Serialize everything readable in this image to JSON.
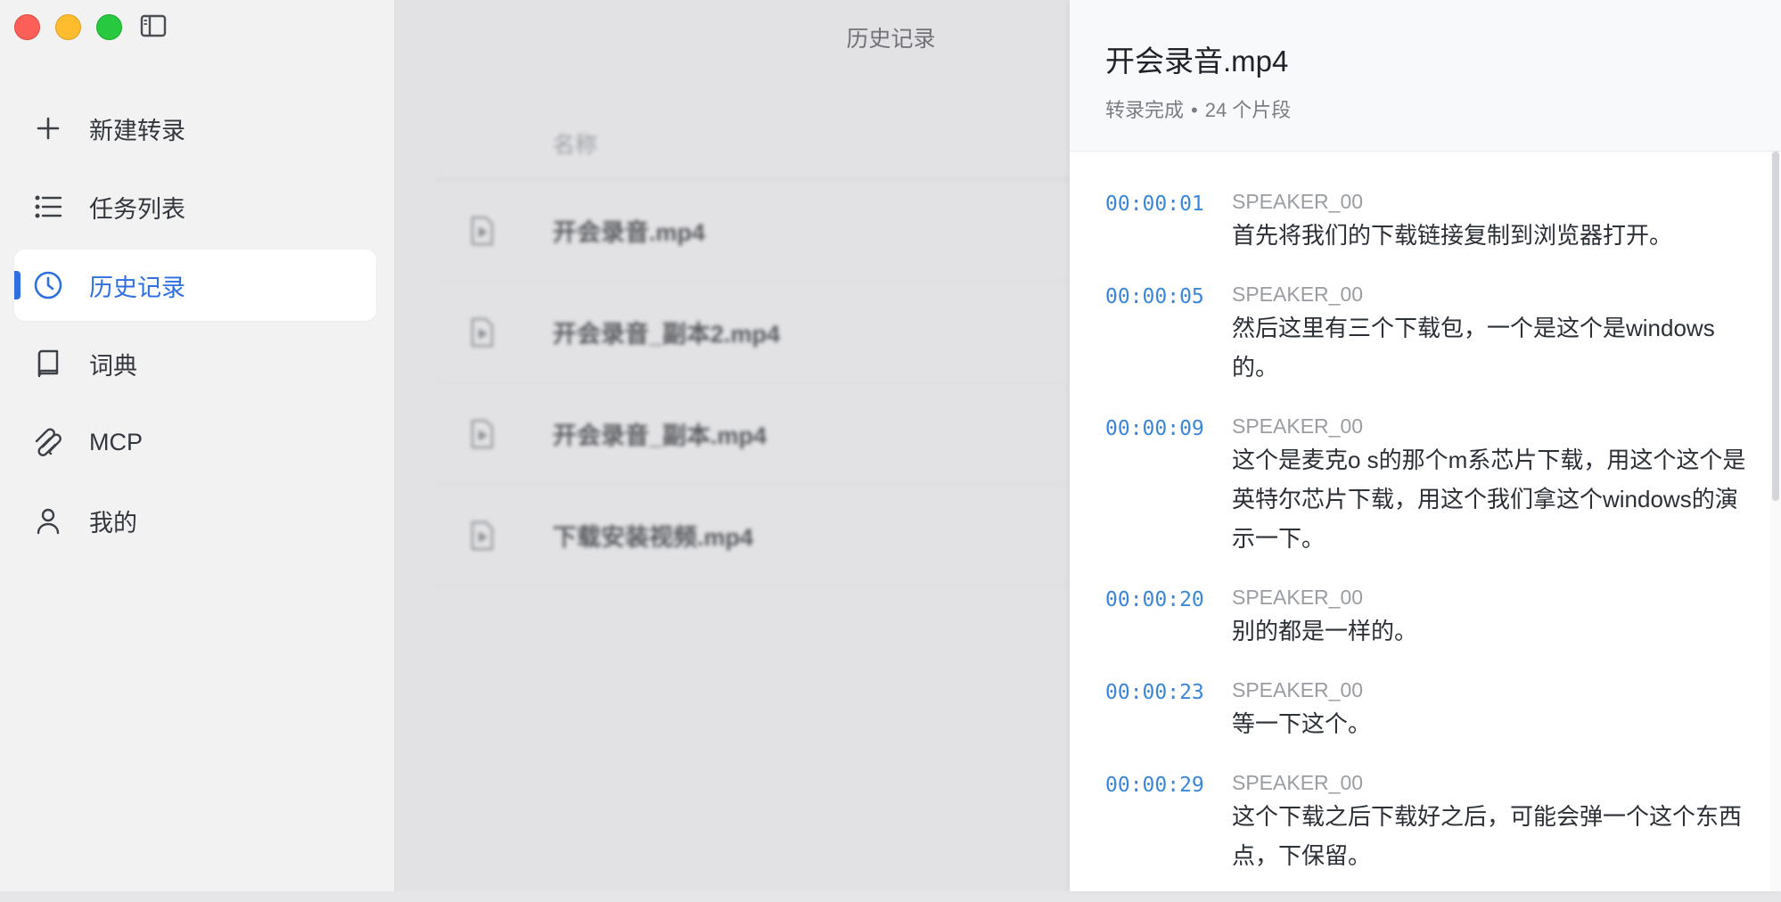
{
  "window": {
    "controls": [
      "close",
      "minimize",
      "zoom"
    ]
  },
  "sidebar": {
    "items": [
      {
        "label": "新建转录",
        "icon": "plus-icon"
      },
      {
        "label": "任务列表",
        "icon": "list-icon"
      },
      {
        "label": "历史记录",
        "icon": "clock-icon",
        "active": true
      },
      {
        "label": "词典",
        "icon": "book-icon"
      },
      {
        "label": "MCP",
        "icon": "mcp-icon"
      },
      {
        "label": "我的",
        "icon": "user-icon"
      }
    ]
  },
  "main": {
    "title": "历史记录",
    "column_header": "名称",
    "files": [
      {
        "name": "开会录音.mp4"
      },
      {
        "name": "开会录音_副本2.mp4"
      },
      {
        "name": "开会录音_副本.mp4"
      },
      {
        "name": "下载安装视频.mp4"
      }
    ]
  },
  "panel": {
    "title": "开会录音.mp4",
    "status": "转录完成",
    "separator": "•",
    "segment_count": "24 个片段",
    "segments": [
      {
        "time": "00:00:01",
        "speaker": "SPEAKER_00",
        "text": "首先将我们的下载链接复制到浏览器打开。"
      },
      {
        "time": "00:00:05",
        "speaker": "SPEAKER_00",
        "text": "然后这里有三个下载包，一个是这个是windows的。"
      },
      {
        "time": "00:00:09",
        "speaker": "SPEAKER_00",
        "text": "这个是麦克o s的那个m系芯片下载，用这个这个是英特尔芯片下载，用这个我们拿这个windows的演示一下。"
      },
      {
        "time": "00:00:20",
        "speaker": "SPEAKER_00",
        "text": "别的都是一样的。"
      },
      {
        "time": "00:00:23",
        "speaker": "SPEAKER_00",
        "text": "等一下这个。"
      },
      {
        "time": "00:00:29",
        "speaker": "SPEAKER_00",
        "text": "这个下载之后下载好之后，可能会弹一个这个东西点，下保留。"
      }
    ]
  },
  "colors": {
    "accent": "#2f6fe0",
    "timestamp": "#3a86d8",
    "close": "#fe5f57",
    "minimize": "#febc2e",
    "zoom": "#28c840"
  }
}
